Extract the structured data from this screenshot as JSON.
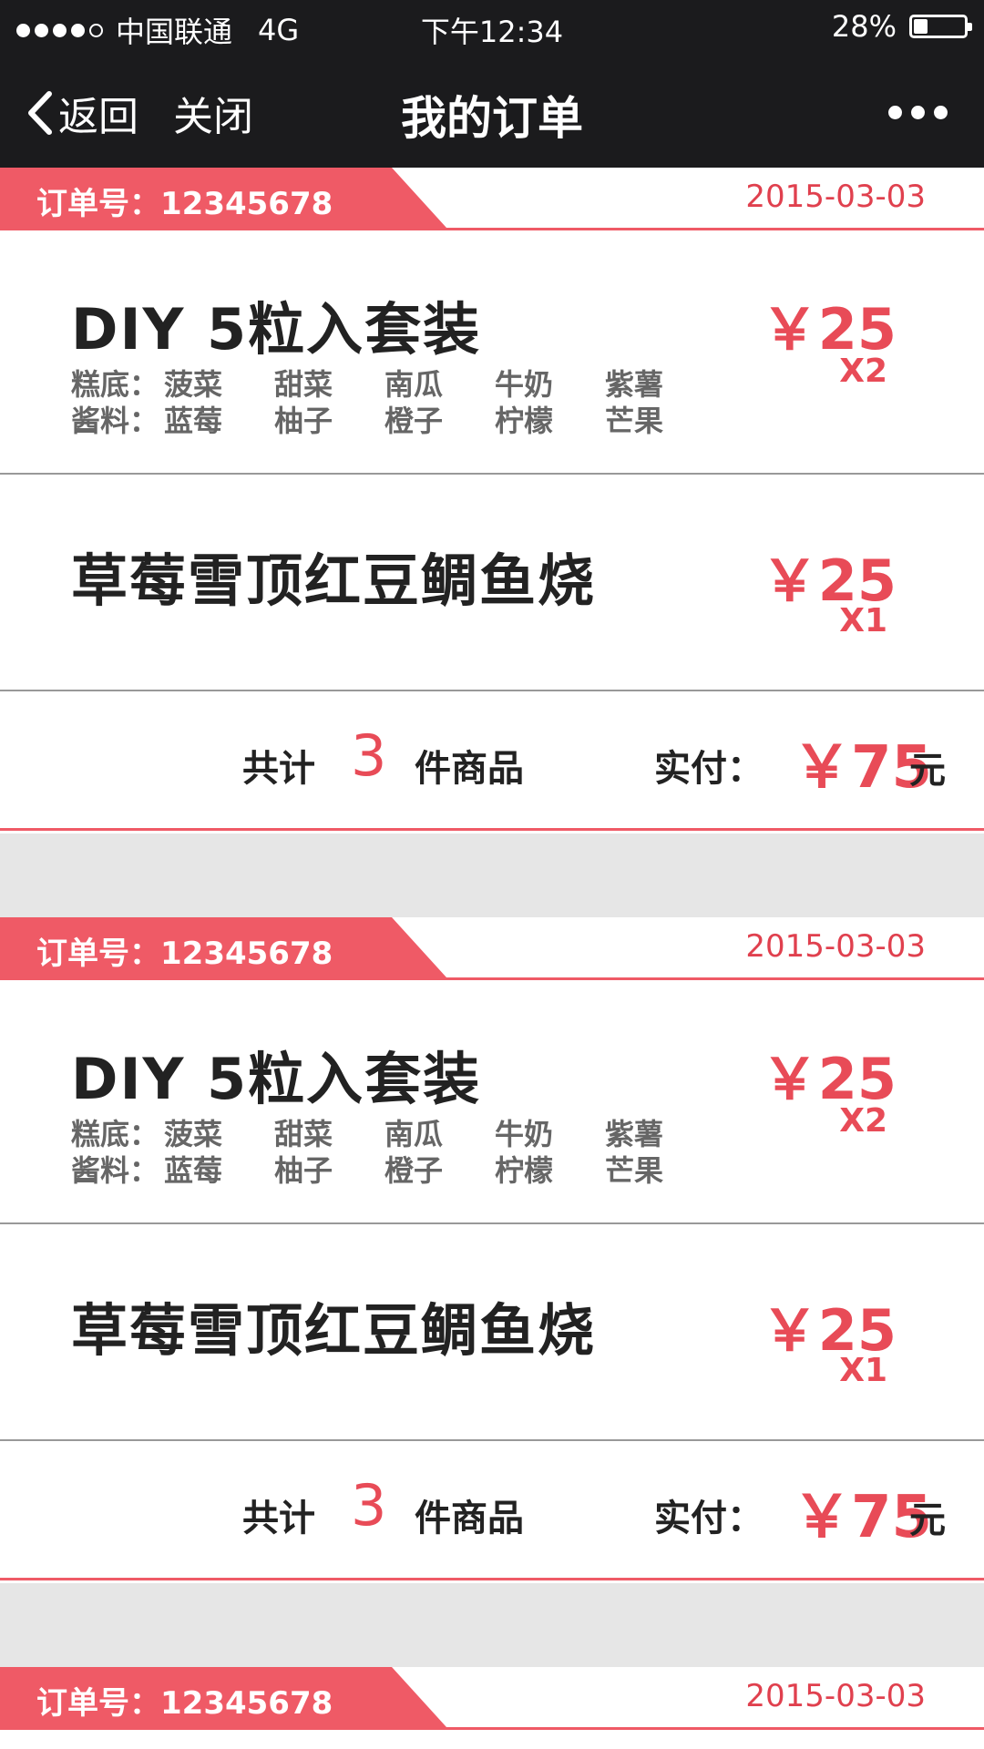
{
  "status": {
    "carrier": "中国联通",
    "network": "4G",
    "time": "下午12:34",
    "battery_percent": "28%",
    "battery_level": 0.28
  },
  "nav": {
    "back_label": "返回",
    "close_label": "关闭",
    "title": "我的订单"
  },
  "colors": {
    "accent": "#ef5a66",
    "price": "#e84b57",
    "nav_bg": "#1b1b1d",
    "gap_bg": "#e6e6e6"
  },
  "orders": [
    {
      "order_no": "订单号：12345678",
      "date": "2015-03-03",
      "items": [
        {
          "title": "DIY 5粒入套装",
          "price": "￥25",
          "qty": "X2",
          "options": [
            {
              "label": "糕底：",
              "values": [
                "菠菜",
                "甜菜",
                "南瓜",
                "牛奶",
                "紫薯"
              ]
            },
            {
              "label": "酱料：",
              "values": [
                "蓝莓",
                "柚子",
                "橙子",
                "柠檬",
                "芒果"
              ]
            }
          ]
        },
        {
          "title": "草莓雪顶红豆鲷鱼烧",
          "price": "￥25",
          "qty": "X1"
        }
      ],
      "summary": {
        "total_prefix": "共计",
        "total_count": "3",
        "total_suffix": "件商品",
        "paid_label": "实付：",
        "paid_value": "￥75",
        "paid_unit": "元"
      }
    },
    {
      "order_no": "订单号：12345678",
      "date": "2015-03-03",
      "items": [
        {
          "title": "DIY 5粒入套装",
          "price": "￥25",
          "qty": "X2",
          "options": [
            {
              "label": "糕底：",
              "values": [
                "菠菜",
                "甜菜",
                "南瓜",
                "牛奶",
                "紫薯"
              ]
            },
            {
              "label": "酱料：",
              "values": [
                "蓝莓",
                "柚子",
                "橙子",
                "柠檬",
                "芒果"
              ]
            }
          ]
        },
        {
          "title": "草莓雪顶红豆鲷鱼烧",
          "price": "￥25",
          "qty": "X1"
        }
      ],
      "summary": {
        "total_prefix": "共计",
        "total_count": "3",
        "total_suffix": "件商品",
        "paid_label": "实付：",
        "paid_value": "￥75",
        "paid_unit": "元"
      }
    },
    {
      "order_no": "订单号：12345678",
      "date": "2015-03-03"
    }
  ]
}
